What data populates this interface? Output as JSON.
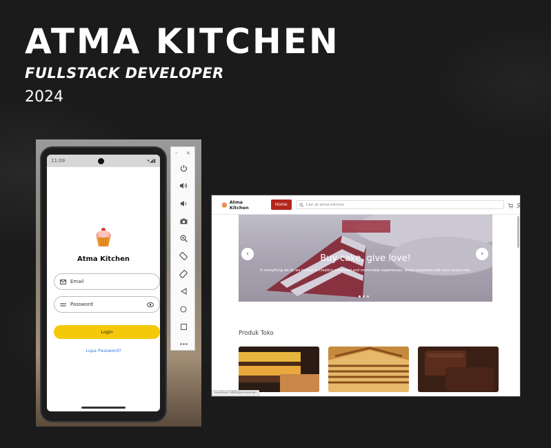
{
  "header": {
    "title": "ATMA KITCHEN",
    "subtitle": "FULLSTACK DEVELOPER",
    "year": "2024"
  },
  "phone": {
    "status_time": "11:09",
    "app_title": "Atma Kitchen",
    "email_placeholder": "Email",
    "password_placeholder": "Password",
    "login_label": "Login",
    "forgot_label": "Lupa Password?"
  },
  "web": {
    "brand": "Atma Kitchen",
    "home_label": "Home",
    "search_placeholder": "Cari di atma kitchen",
    "hero_title": "Buy cake, give love!",
    "hero_subtitle": "In everything we do we believe in creating emotional and memorable experiences. Share happiness with your loved ones.",
    "section_title": "Produk Toko",
    "status_url": "localhost:3000/pemesanan"
  },
  "colors": {
    "accent_red": "#b3261e",
    "accent_yellow": "#f4c90a",
    "link_blue": "#3b7bd6",
    "background": "#1b1b1b"
  }
}
